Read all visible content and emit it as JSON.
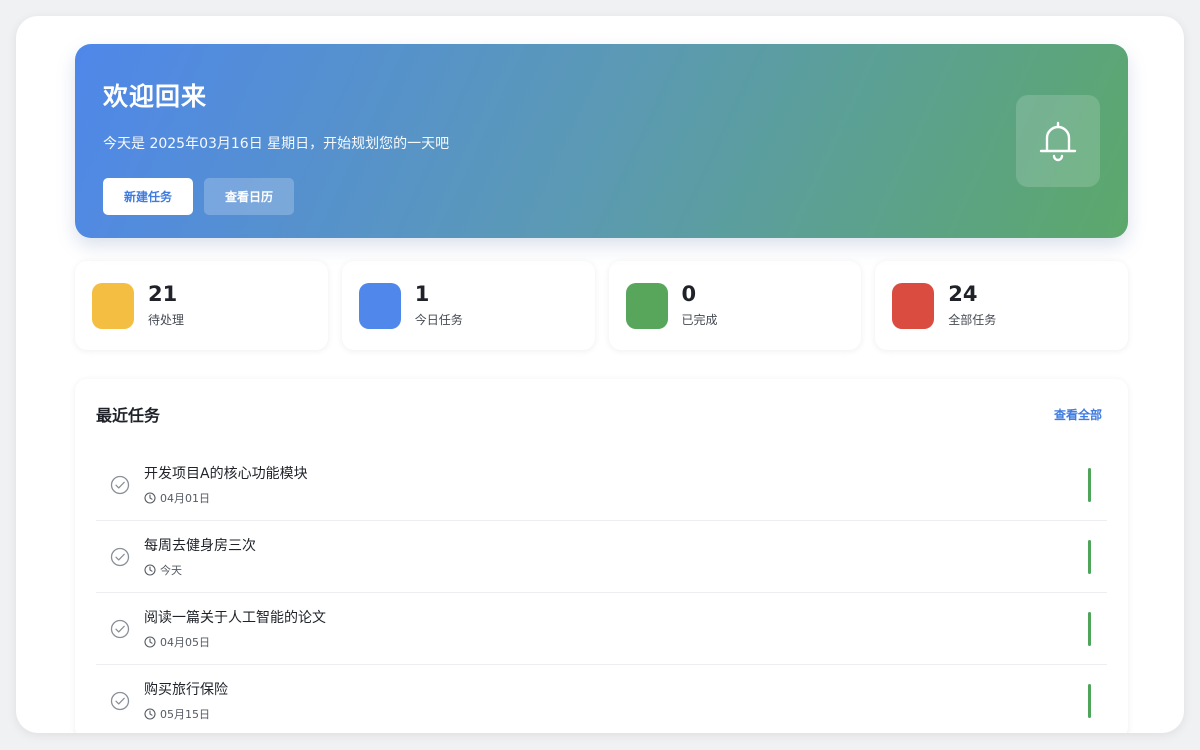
{
  "hero": {
    "title": "欢迎回来",
    "subtitle": "今天是 2025年03月16日 星期日，开始规划您的一天吧",
    "new_task_label": "新建任务",
    "view_calendar_label": "查看日历",
    "icon": "bell-icon"
  },
  "stats": [
    {
      "value": "21",
      "label": "待处理",
      "color": "#f4be42"
    },
    {
      "value": "1",
      "label": "今日任务",
      "color": "#4f87ea"
    },
    {
      "value": "0",
      "label": "已完成",
      "color": "#58a55c"
    },
    {
      "value": "24",
      "label": "全部任务",
      "color": "#db4c40"
    }
  ],
  "recent": {
    "title": "最近任务",
    "view_all_label": "查看全部",
    "tasks": [
      {
        "title": "开发项目A的核心功能模块",
        "date": "04月01日"
      },
      {
        "title": "每周去健身房三次",
        "date": "今天"
      },
      {
        "title": "阅读一篇关于人工智能的论文",
        "date": "04月05日"
      },
      {
        "title": "购买旅行保险",
        "date": "05月15日"
      }
    ]
  },
  "colors": {
    "accent": "#3f7be0",
    "priority_low": "#4ea55a"
  }
}
